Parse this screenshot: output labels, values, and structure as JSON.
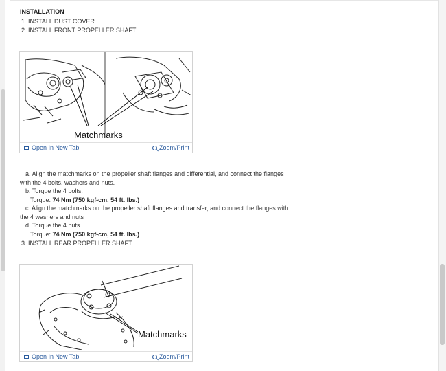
{
  "section": {
    "heading": "INSTALLATION",
    "step1": "1. INSTALL DUST COVER",
    "step2": "2. INSTALL FRONT PROPELLER SHAFT",
    "step3": "3. INSTALL REAR PROPELLER SHAFT"
  },
  "figure1": {
    "label": "Matchmarks",
    "open_link": "Open In New Tab",
    "zoom_link": "Zoom/Print",
    "open_icon": "new-tab-icon",
    "zoom_icon": "magnifier-icon"
  },
  "figure2": {
    "label": "Matchmarks",
    "open_link": "Open In New Tab",
    "zoom_link": "Zoom/Print",
    "open_icon": "new-tab-icon",
    "zoom_icon": "magnifier-icon"
  },
  "substeps": {
    "a_line1": "a. Align the matchmarks on the propeller shaft flanges and differential, and connect the flanges",
    "a_line2": "with the 4 bolts, washers and nuts.",
    "b": "b. Torque the 4 bolts.",
    "b_torque_label": "Torque:",
    "b_torque_value": "74 Nm (750 kgf-cm, 54 ft. lbs.)",
    "c_line1": "c. Align the matchmarks on the propeller shaft flanges and transfer, and connect the flanges with",
    "c_line2": "the 4 washers and nuts",
    "d": "d. Torque the 4 nuts.",
    "d_torque_label": "Torque:",
    "d_torque_value": "74 Nm (750 kgf-cm, 54 ft. lbs.)"
  },
  "colors": {
    "link": "#2b5c9e",
    "text": "#333333",
    "border": "#d2d2d2"
  }
}
